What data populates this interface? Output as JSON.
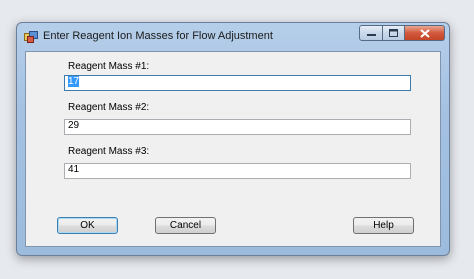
{
  "window": {
    "title": "Enter Reagent Ion Masses for Flow Adjustment",
    "controls": {
      "minimize": "minimize",
      "maximize": "maximize",
      "close": "close"
    }
  },
  "fields": [
    {
      "label": "Reagent Mass #1:",
      "value": "17",
      "focused": true
    },
    {
      "label": "Reagent Mass #2:",
      "value": "29"
    },
    {
      "label": "Reagent Mass #3:",
      "value": "41"
    }
  ],
  "buttons": {
    "ok": "OK",
    "cancel": "Cancel",
    "help": "Help"
  },
  "colors": {
    "titlebar": "#a4c1e2",
    "client": "#f0f0f0",
    "close_button": "#c44326",
    "selection": "#3399ff"
  }
}
